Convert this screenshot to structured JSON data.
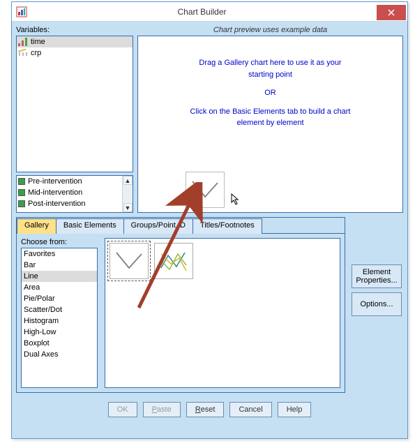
{
  "window": {
    "title": "Chart Builder"
  },
  "variables": {
    "label": "Variables:",
    "items": [
      {
        "name": "time",
        "selected": true,
        "iconColor": "#c85a5a"
      },
      {
        "name": "crp",
        "selected": false,
        "iconColor": "#d8c04a"
      }
    ]
  },
  "categories": {
    "items": [
      {
        "name": "Pre-intervention",
        "color": "#3aa046"
      },
      {
        "name": "Mid-intervention",
        "color": "#3aa046"
      },
      {
        "name": "Post-intervention",
        "color": "#3aa046"
      }
    ]
  },
  "preview": {
    "label": "Chart preview uses example data",
    "line1": "Drag a Gallery chart here to use it as your",
    "line2": "starting point",
    "or": "OR",
    "line3": "Click on the Basic Elements tab to build a chart",
    "line4": "element by element"
  },
  "tabs": {
    "gallery": "Gallery",
    "basic": "Basic Elements",
    "groups": "Groups/Point ID",
    "titles": "Titles/Footnotes"
  },
  "gallery": {
    "choose_label": "Choose from:",
    "items": [
      "Favorites",
      "Bar",
      "Line",
      "Area",
      "Pie/Polar",
      "Scatter/Dot",
      "Histogram",
      "High-Low",
      "Boxplot",
      "Dual Axes"
    ],
    "selected": "Line"
  },
  "side_buttons": {
    "element_props": "Element Properties...",
    "options": "Options..."
  },
  "footer": {
    "ok": "OK",
    "paste": "Paste",
    "reset": "Reset",
    "cancel": "Cancel",
    "help": "Help"
  }
}
